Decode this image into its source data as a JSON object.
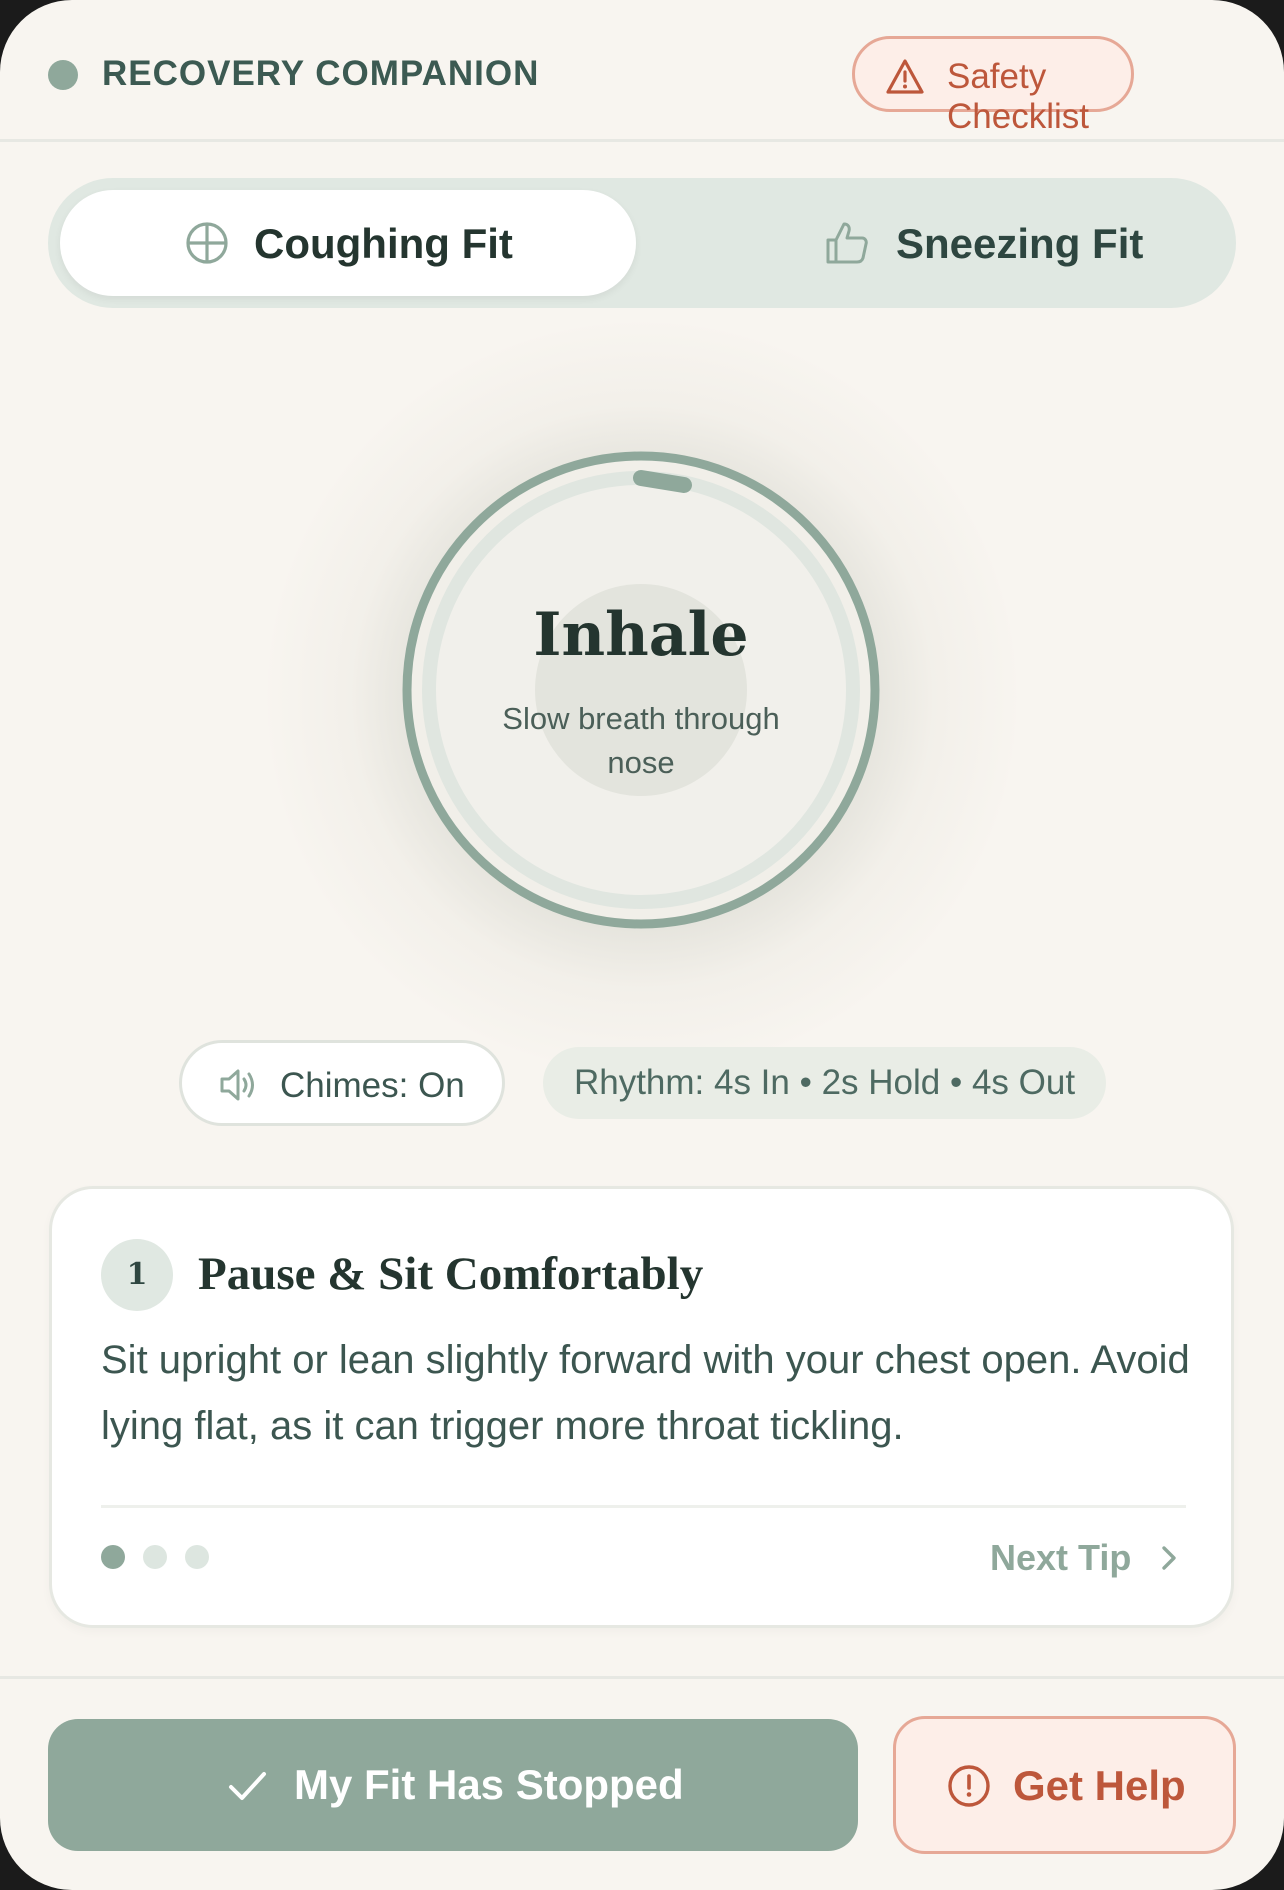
{
  "header": {
    "brand": "RECOVERY COMPANION",
    "safety_label": "Safety Checklist",
    "safety_icon": "warning-triangle-icon"
  },
  "tabs": [
    {
      "label": "Coughing Fit",
      "icon": "crosshair-circle-icon",
      "active": true
    },
    {
      "label": "Sneezing Fit",
      "icon": "thumbs-up-icon",
      "active": false
    }
  ],
  "breathing": {
    "phase": "Inhale",
    "instruction": "Slow breath through nose"
  },
  "audio": {
    "label": "Chimes: On",
    "icon": "speaker-icon"
  },
  "rhythm": {
    "label": "Rhythm: 4s In • 2s Hold • 4s Out"
  },
  "tip": {
    "step": "1",
    "title": "Pause & Sit Comfortably",
    "body": "Sit upright or lean slightly forward with your chest open. Avoid lying flat, as it can trigger more throat tickling.",
    "current_index": 1,
    "total": 3,
    "next_label": "Next Tip",
    "next_icon": "chevron-right-icon"
  },
  "footer": {
    "primary_label": "My Fit Has Stopped",
    "primary_icon": "check-icon",
    "help_label": "Get Help",
    "help_icon": "alert-circle-icon"
  },
  "colors": {
    "background": "#f8f5f0",
    "sage": "#8fa89b",
    "dark_text": "#24352f",
    "alert": "#bd573b",
    "alert_bg": "#fdeee8"
  }
}
